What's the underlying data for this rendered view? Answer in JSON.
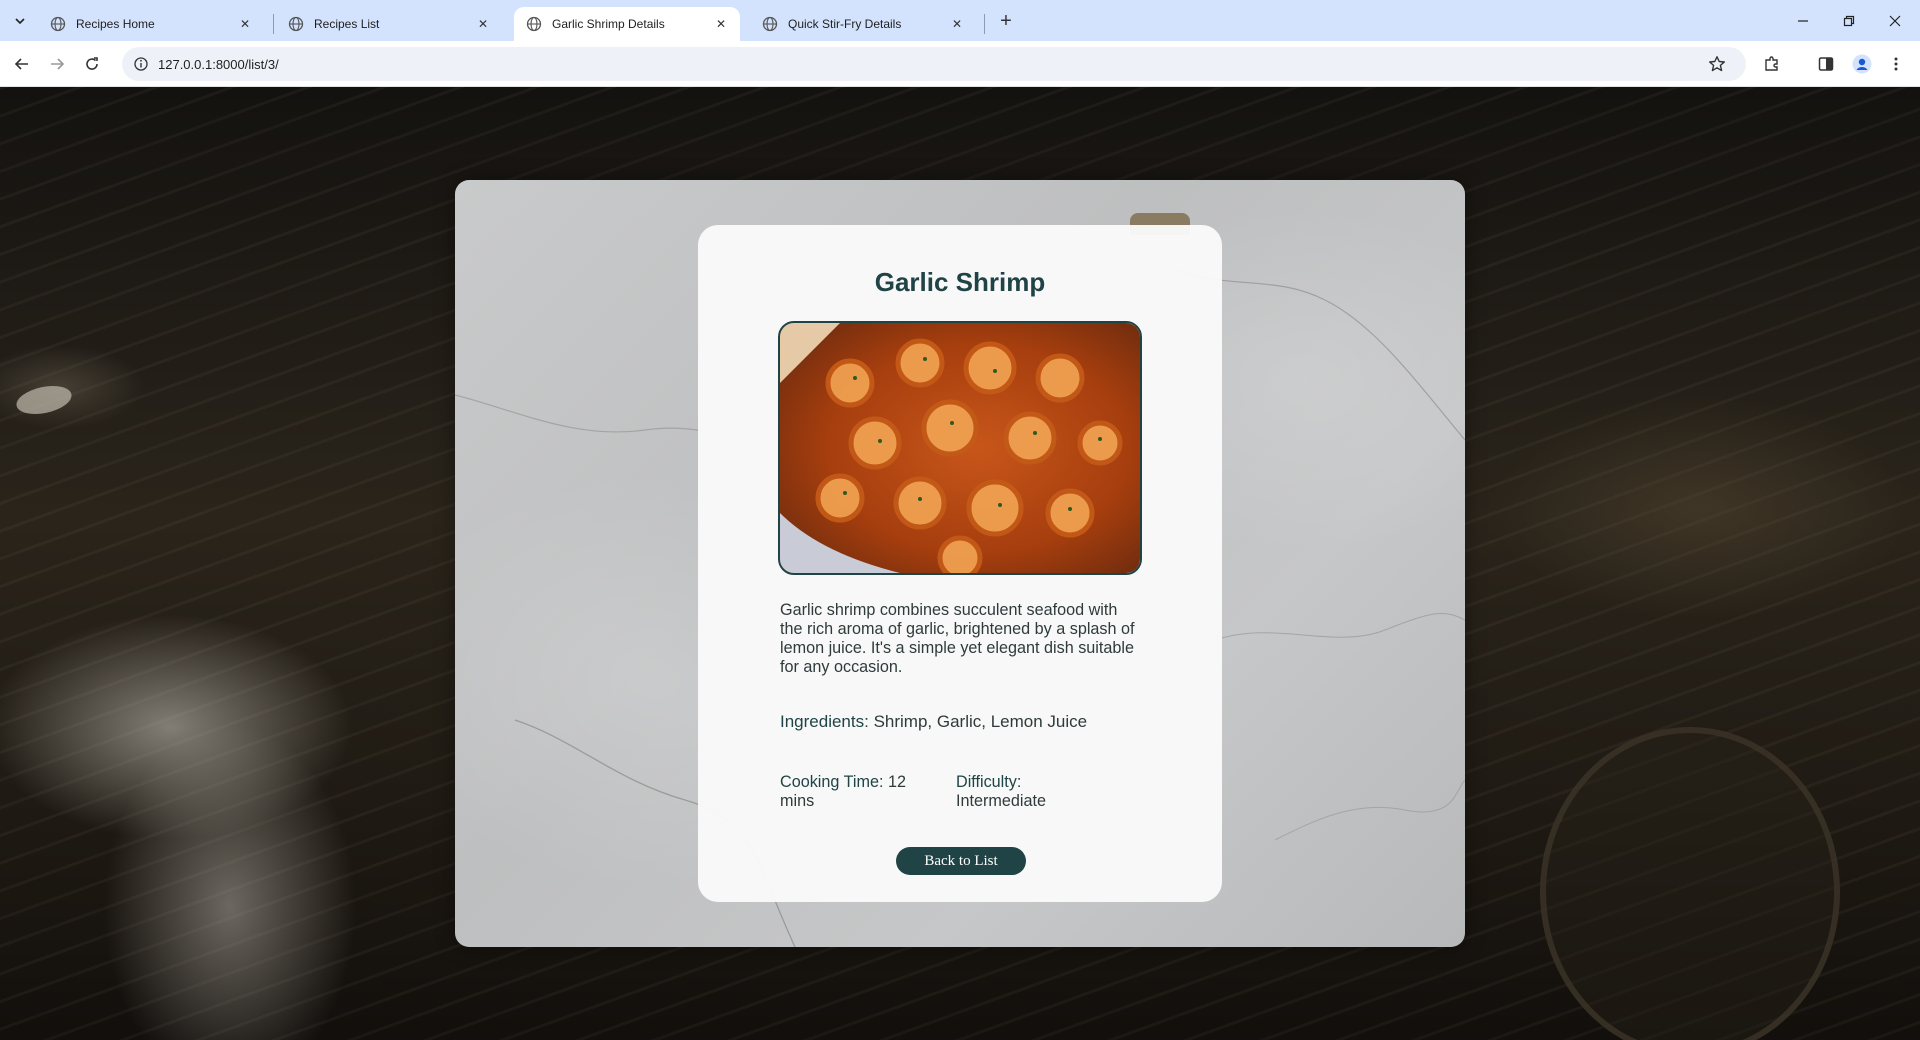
{
  "browser": {
    "tabs": [
      {
        "title": "Recipes Home",
        "active": false
      },
      {
        "title": "Recipes List",
        "active": false
      },
      {
        "title": "Garlic Shrimp Details",
        "active": true
      },
      {
        "title": "Quick Stir-Fry Details",
        "active": false
      }
    ],
    "url": "127.0.0.1:8000/list/3/"
  },
  "recipe": {
    "title": "Garlic Shrimp",
    "image_alt": "shrimp-dish-photo",
    "description": "Garlic shrimp combines succulent seafood with the rich aroma of garlic, brightened by a splash of lemon juice. It's a simple yet elegant dish suitable for any occasion.",
    "ingredients_label": "Ingredients:",
    "ingredients_value": "Shrimp, Garlic, Lemon Juice",
    "cooking_time_label": "Cooking Time:",
    "cooking_time_value": "12 mins",
    "difficulty_label": "Difficulty:",
    "difficulty_value": "Intermediate",
    "back_button": "Back to List"
  },
  "colors": {
    "accent": "#204446",
    "tabstrip": "#d3e3fd"
  }
}
